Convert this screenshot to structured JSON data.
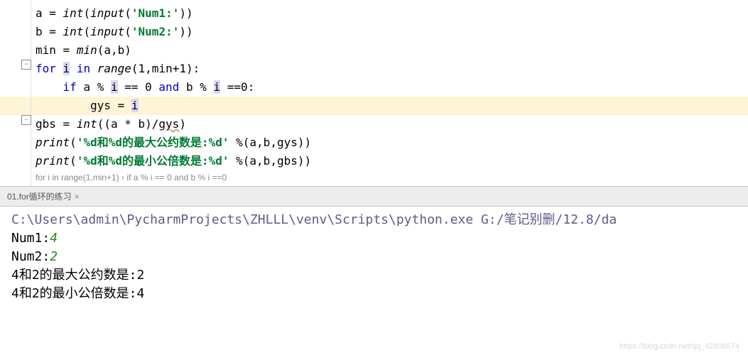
{
  "code": {
    "line1": {
      "a": "a",
      "eq": " = ",
      "fn": "int",
      "p1": "(",
      "fn2": "input",
      "p2": "(",
      "str": "'Num1:'",
      "p3": "))"
    },
    "line2": {
      "b": "b",
      "eq": " = ",
      "fn": "int",
      "p1": "(",
      "fn2": "input",
      "p2": "(",
      "str": "'Num2:'",
      "p3": "))"
    },
    "line3": {
      "v": "min",
      "eq": " = ",
      "fn": "min",
      "args": "(a,b)"
    },
    "line4": {
      "kw1": "for",
      "sp1": " ",
      "i": "i",
      "sp2": " ",
      "kw2": "in",
      "sp3": " ",
      "fn": "range",
      "args": "(1,min+1):"
    },
    "line5": {
      "indent": "    ",
      "kw": "if",
      "sp": " ",
      "a": "a ",
      "pct1": "%",
      "sp2": " ",
      "i1": "i",
      "sp3": " == 0 ",
      "kw2": "and",
      "sp4": " b ",
      "pct2": "%",
      "sp5": " ",
      "i2": "i",
      "tail": " ==0:"
    },
    "line6": {
      "indent": "        ",
      "v": "gys = ",
      "i": "i"
    },
    "line7": {
      "v": "gbs = ",
      "fn": "int",
      "p": "((a * b)/",
      "g": "gys",
      "e": ")"
    },
    "line8": {
      "fn": "print",
      "p1": "(",
      "str": "'%d和%d的最大公约数是:%d'",
      "args": " %(a,b,gys))"
    },
    "line9": {
      "fn": "print",
      "p1": "(",
      "str": "'%d和%d的最小公倍数是:%d'",
      "args": " %(a,b,gbs))"
    }
  },
  "breadcrumb": {
    "part1": "for i in range(1,min+1)",
    "sep": "  ›  ",
    "part2": "if a % i == 0 and b % i ==0"
  },
  "tab": {
    "label": "01.for循环的练习",
    "close": "×"
  },
  "console": {
    "cmd": "C:\\Users\\admin\\PycharmProjects\\ZHLLL\\venv\\Scripts\\python.exe G:/笔记别删/12.8/da",
    "p1_lbl": "Num1:",
    "p1_val": "4",
    "p2_lbl": "Num2:",
    "p2_val": "2",
    "out1": "4和2的最大公约数是:2",
    "out2": "4和2的最小公倍数是:4"
  },
  "watermark": "https://blog.csdn.net/qq_42806574"
}
